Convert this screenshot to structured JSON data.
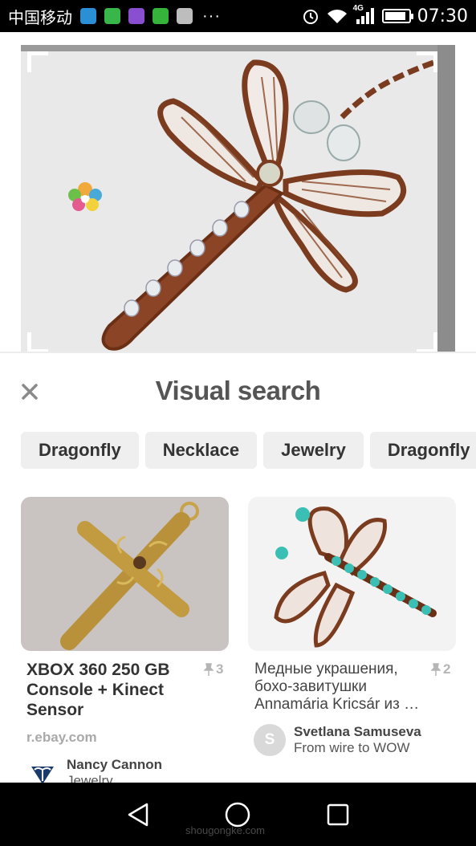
{
  "status_bar": {
    "carrier": "中国移动",
    "network": "4G",
    "time": "07:30",
    "more": "···",
    "battery_level": 0.9
  },
  "hero": {
    "description_icon": "dragonfly-pendant-image"
  },
  "visual_search": {
    "title": "Visual search",
    "close_icon": "close-icon"
  },
  "chips": [
    "Dragonfly",
    "Necklace",
    "Jewelry",
    "Dragonfly"
  ],
  "results": [
    {
      "title": "XBOX 360 250 GB Console + Kinect Sensor",
      "saves": "3",
      "source": "r.ebay.com",
      "user_name": "Nancy Cannon",
      "user_board": "Jewelry"
    },
    {
      "title": "Медные украшения, бохо-завитушки Annamária Kricsár из …",
      "saves": "2",
      "source": "",
      "user_initial": "S",
      "user_name": "Svetlana Samuseva",
      "user_board": "From wire to WOW"
    }
  ],
  "watermark": "shougongke.com",
  "colors": {
    "status_bar": "#000000",
    "chip_bg": "#efefef",
    "title_text": "#555555",
    "copper": "#7a3b1f"
  }
}
